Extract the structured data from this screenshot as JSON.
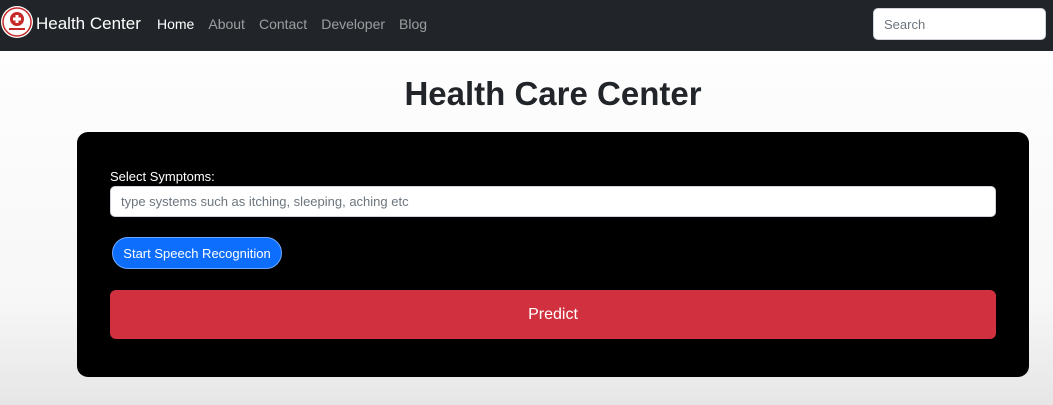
{
  "navbar": {
    "brand": "Health Center",
    "logo_icon": "health-care-logo-icon",
    "links": [
      {
        "label": "Home",
        "active": true
      },
      {
        "label": "About",
        "active": false
      },
      {
        "label": "Contact",
        "active": false
      },
      {
        "label": "Developer",
        "active": false
      },
      {
        "label": "Blog",
        "active": false
      }
    ],
    "search": {
      "placeholder": "Search",
      "value": ""
    }
  },
  "main": {
    "title": "Health Care Center",
    "form": {
      "symptoms_label": "Select Symptoms:",
      "symptoms_placeholder": "type systems such as itching, sleeping, aching etc",
      "symptoms_value": "",
      "speech_button": "Start Speech Recognition",
      "predict_button": "Predict"
    }
  },
  "colors": {
    "navbar_bg": "#212529",
    "card_bg": "#000000",
    "primary": "#0d6efd",
    "danger": "#d1313f"
  }
}
